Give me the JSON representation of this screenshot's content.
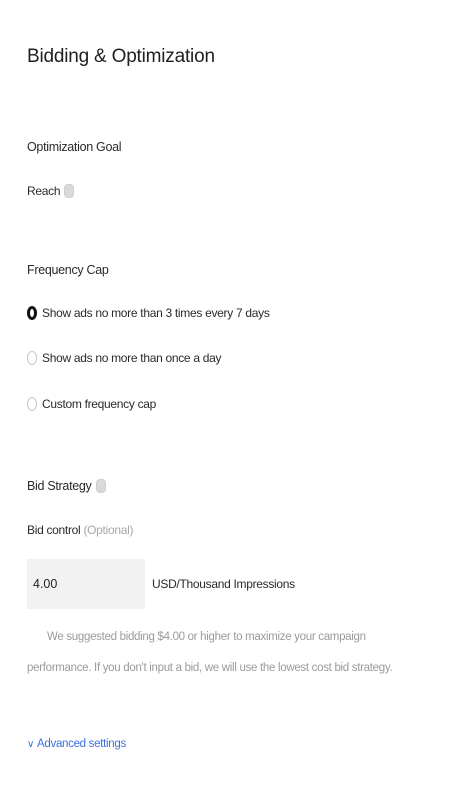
{
  "section": {
    "title": "Bidding & Optimization"
  },
  "optimization": {
    "label": "Optimization Goal",
    "value": "Reach"
  },
  "frequency": {
    "label": "Frequency Cap",
    "options": [
      {
        "label": "Show ads no more than 3 times every 7 days",
        "selected": true
      },
      {
        "label": "Show ads no more than once a day",
        "selected": false
      },
      {
        "label": "Custom frequency cap",
        "selected": false
      }
    ]
  },
  "bid": {
    "strategy_label": "Bid Strategy",
    "control_label": "Bid control",
    "optional": "(Optional)",
    "value": "4.00",
    "unit": "USD/Thousand Impressions",
    "hint": "We suggested bidding $4.00 or higher to maximize your campaign performance. If you don't input a bid, we will use the lowest cost bid strategy."
  },
  "advanced": {
    "label": "Advanced settings"
  },
  "colors": {
    "link": "#3b6fe0",
    "input_bg": "#f2f2f2",
    "radio_checked": "#111111"
  }
}
